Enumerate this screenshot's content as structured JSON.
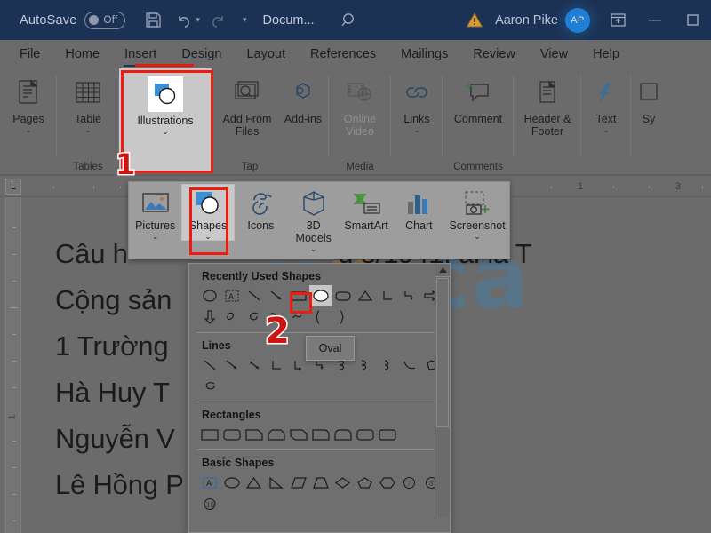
{
  "titlebar": {
    "autosave_label": "AutoSave",
    "toggle_state": "Off",
    "save_icon": "save-icon",
    "undo_icon": "undo-icon",
    "redo_icon": "redo-icon",
    "document_name": "Docum...",
    "search_icon": "search-icon",
    "warning_icon": "warning-triangle-icon",
    "user_name": "Aaron Pike",
    "avatar_initials": "AP",
    "ribbon_display_icon": "ribbon-display-options-icon",
    "minimize_label": "—",
    "restore_label": "□",
    "background_color": "#1c3254",
    "accent_color": "#1f7fd4"
  },
  "tabs": [
    {
      "label": "File"
    },
    {
      "label": "Home"
    },
    {
      "label": "Insert",
      "active": true
    },
    {
      "label": "Design"
    },
    {
      "label": "Layout"
    },
    {
      "label": "References"
    },
    {
      "label": "Mailings"
    },
    {
      "label": "Review"
    },
    {
      "label": "View"
    },
    {
      "label": "Help"
    }
  ],
  "ribbon": {
    "groups": [
      {
        "name": "",
        "buttons": [
          {
            "label": "Pages",
            "icon": "pages-icon",
            "dropdown": true
          }
        ]
      },
      {
        "name": "Tables",
        "buttons": [
          {
            "label": "Table",
            "icon": "table-icon",
            "dropdown": true
          }
        ]
      },
      {
        "name": "",
        "buttons": [
          {
            "label": "Illustrations",
            "icon": "illustrations-icon",
            "dropdown": true,
            "highlighted": true
          }
        ]
      },
      {
        "name": "Tap",
        "buttons": [
          {
            "label": "Add From Files",
            "icon": "add-from-files-icon",
            "dropdown": false
          },
          {
            "label": "Add-ins",
            "icon": "addins-icon",
            "dropdown": true
          }
        ]
      },
      {
        "name": "Media",
        "buttons": [
          {
            "label": "Online Video",
            "icon": "online-video-icon",
            "disabled": true
          }
        ]
      },
      {
        "name": "",
        "buttons": [
          {
            "label": "Links",
            "icon": "links-icon",
            "dropdown": true
          }
        ]
      },
      {
        "name": "Comments",
        "buttons": [
          {
            "label": "Comment",
            "icon": "comment-icon",
            "dropdown": false
          }
        ]
      },
      {
        "name": "",
        "buttons": [
          {
            "label": "Header & Footer",
            "icon": "header-footer-icon",
            "dropdown": true
          }
        ]
      },
      {
        "name": "",
        "buttons": [
          {
            "label": "Text",
            "icon": "text-icon",
            "dropdown": true
          }
        ]
      },
      {
        "name": "",
        "buttons": [
          {
            "label": "Sy",
            "icon": "symbols-icon",
            "dropdown": false
          }
        ]
      }
    ]
  },
  "ruler": {
    "horizontal_numbers": [
      "1",
      "3"
    ],
    "tab_stop_marker": "L"
  },
  "illustrations_panel": {
    "items": [
      {
        "label": "Pictures",
        "icon": "pictures-icon",
        "dropdown": true
      },
      {
        "label": "Shapes",
        "icon": "shapes-icon",
        "dropdown": true,
        "selected": true
      },
      {
        "label": "Icons",
        "icon": "icons-icon",
        "dropdown": false
      },
      {
        "label": "3D Models",
        "icon": "3d-models-icon",
        "dropdown": true
      },
      {
        "label": "SmartArt",
        "icon": "smartart-icon",
        "dropdown": false
      },
      {
        "label": "Chart",
        "icon": "chart-icon",
        "dropdown": false
      },
      {
        "label": "Screenshot",
        "icon": "screenshot-icon",
        "dropdown": true
      }
    ]
  },
  "shapes_gallery": {
    "sections": [
      {
        "title": "Recently Used Shapes",
        "count": 24,
        "selected_index": 9
      },
      {
        "title": "Lines",
        "count": 12
      },
      {
        "title": "Rectangles",
        "count": 9
      },
      {
        "title": "Basic Shapes",
        "count": 11
      }
    ],
    "tooltip": "Oval",
    "scrollbar": true
  },
  "document": {
    "lines": [
      {
        "text": "Câu h",
        "suffix": "g 8/1941, ai là T"
      },
      {
        "text": "Cộng sản"
      },
      {
        "text": "1  Trường",
        "cursor": true
      },
      {
        "text": "Hà Huy T"
      },
      {
        "text": "Nguyễn V"
      },
      {
        "text": "Lê Hồng P"
      }
    ],
    "watermark": "unica",
    "watermark_colors": [
      "#3f7fae",
      "#d98b3a",
      "#3f7fae",
      "#3f7fae",
      "#3f7fae"
    ]
  },
  "annotations": {
    "step1": "1",
    "step2": "2",
    "color": "#ef1b10"
  }
}
